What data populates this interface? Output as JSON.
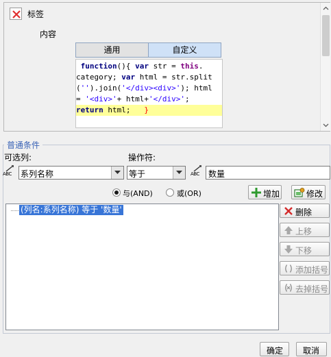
{
  "top_panel": {
    "label_title": "标签",
    "content_label": "内容",
    "tabs": [
      {
        "label": "通用",
        "active": false
      },
      {
        "label": "自定义",
        "active": true
      }
    ],
    "code_lines": [
      " function(){ var str = this.",
      "category; var html = str.split",
      "('').join('</div><div>'); html",
      "= '<div>'+ html+'</div>';",
      "return html;   }"
    ]
  },
  "conditions": {
    "group_title": "普通条件",
    "field_label": "可选列:",
    "operator_label": "操作符:",
    "field_value": "系列名称",
    "operator_value": "等于",
    "value_input": "数量",
    "type_icon_text": "ABC",
    "radio_and_label": "与(AND)",
    "radio_or_label": "或(OR)",
    "logic_selected": "AND",
    "add_label": "增加",
    "edit_label": "修改",
    "list_items": [
      "(列名:系列名称) 等于 '数量'"
    ],
    "delete_label": "删除",
    "move_up_label": "上移",
    "move_down_label": "下移",
    "add_bracket_label": "添加括号",
    "remove_bracket_label": "去掉括号"
  },
  "footer": {
    "ok_label": "确定",
    "cancel_label": "取消"
  },
  "colors": {
    "accent": "#3875d7",
    "group_title": "#3a63b6",
    "code_highlight": "#ffff99",
    "close_red": "#e03030"
  },
  "icons": [
    "close-icon",
    "scroll-up-icon",
    "scroll-down-icon",
    "chevron-down-icon",
    "text-type-icon",
    "plus-icon",
    "edit-icon",
    "delete-icon",
    "arrow-up-icon",
    "arrow-down-icon",
    "bracket-icon",
    "remove-bracket-icon"
  ]
}
